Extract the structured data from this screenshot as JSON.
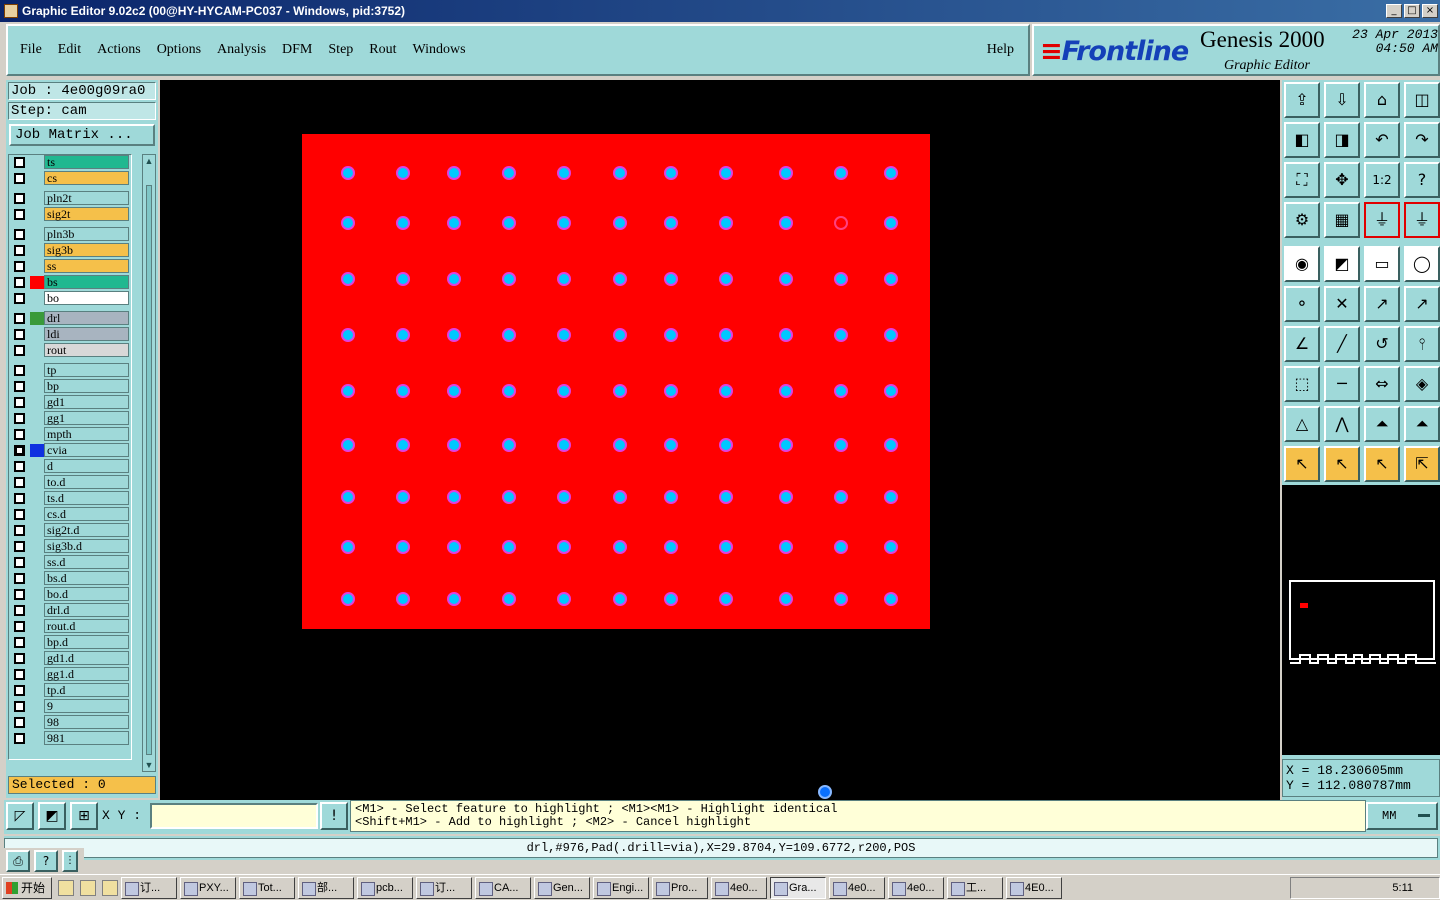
{
  "window": {
    "title": "Graphic Editor 9.02c2 (00@HY-HYCAM-PC037 - Windows, pid:3752)"
  },
  "menu": [
    {
      "label": "File"
    },
    {
      "label": "Edit"
    },
    {
      "label": "Actions"
    },
    {
      "label": "Options"
    },
    {
      "label": "Analysis"
    },
    {
      "label": "DFM"
    },
    {
      "label": "Step"
    },
    {
      "label": "Rout"
    },
    {
      "label": "Windows"
    }
  ],
  "help_label": "Help",
  "brand": {
    "logo": "Frontline",
    "product": "Genesis 2000",
    "subtitle": "Graphic Editor",
    "date": "23 Apr 2013",
    "time": "04:50 AM"
  },
  "job": {
    "job_line": "Job : 4e00g09ra0",
    "step_line": "Step: cam",
    "matrix_button": "Job Matrix ..."
  },
  "layers": [
    {
      "name": "ts",
      "color": "#20b890",
      "swatch": "",
      "on": false
    },
    {
      "name": "cs",
      "color": "#f5c04a",
      "swatch": "",
      "on": false
    },
    {
      "name": "pln2t",
      "color": "#9fd9d9",
      "swatch": "",
      "on": false
    },
    {
      "name": "sig2t",
      "color": "#f5c04a",
      "swatch": "",
      "on": false
    },
    {
      "name": "pln3b",
      "color": "#9fd9d9",
      "swatch": "",
      "on": false
    },
    {
      "name": "sig3b",
      "color": "#f5c04a",
      "swatch": "",
      "on": false
    },
    {
      "name": "ss",
      "color": "#f5c04a",
      "swatch": "",
      "on": false
    },
    {
      "name": "bs",
      "color": "#20b890",
      "swatch": "#ff0000",
      "on": false
    },
    {
      "name": "bo",
      "color": "#ffffff",
      "swatch": "",
      "on": false
    },
    {
      "name": "drl",
      "color": "#a8b4c0",
      "swatch": "#3a9a3a",
      "on": false
    },
    {
      "name": "ldi",
      "color": "#a8b4c0",
      "swatch": "",
      "on": false
    },
    {
      "name": "rout",
      "color": "#d8d8d8",
      "swatch": "",
      "on": false
    },
    {
      "name": "tp",
      "color": "#9fd9d9",
      "swatch": "",
      "on": false
    },
    {
      "name": "bp",
      "color": "#9fd9d9",
      "swatch": "",
      "on": false
    },
    {
      "name": "gd1",
      "color": "#9fd9d9",
      "swatch": "",
      "on": false
    },
    {
      "name": "gg1",
      "color": "#9fd9d9",
      "swatch": "",
      "on": false
    },
    {
      "name": "mpth",
      "color": "#9fd9d9",
      "swatch": "",
      "on": false
    },
    {
      "name": "cvia",
      "color": "#9fd9d9",
      "swatch": "#1030e0",
      "on": true
    },
    {
      "name": "d",
      "color": "#9fd9d9",
      "swatch": "",
      "on": false
    },
    {
      "name": "to.d",
      "color": "#9fd9d9",
      "swatch": "",
      "on": false
    },
    {
      "name": "ts.d",
      "color": "#9fd9d9",
      "swatch": "",
      "on": false
    },
    {
      "name": "cs.d",
      "color": "#9fd9d9",
      "swatch": "",
      "on": false
    },
    {
      "name": "sig2t.d",
      "color": "#9fd9d9",
      "swatch": "",
      "on": false
    },
    {
      "name": "sig3b.d",
      "color": "#9fd9d9",
      "swatch": "",
      "on": false
    },
    {
      "name": "ss.d",
      "color": "#9fd9d9",
      "swatch": "",
      "on": false
    },
    {
      "name": "bs.d",
      "color": "#9fd9d9",
      "swatch": "",
      "on": false
    },
    {
      "name": "bo.d",
      "color": "#9fd9d9",
      "swatch": "",
      "on": false
    },
    {
      "name": "drl.d",
      "color": "#9fd9d9",
      "swatch": "",
      "on": false
    },
    {
      "name": "rout.d",
      "color": "#9fd9d9",
      "swatch": "",
      "on": false
    },
    {
      "name": "bp.d",
      "color": "#9fd9d9",
      "swatch": "",
      "on": false
    },
    {
      "name": "gd1.d",
      "color": "#9fd9d9",
      "swatch": "",
      "on": false
    },
    {
      "name": "gg1.d",
      "color": "#9fd9d9",
      "swatch": "",
      "on": false
    },
    {
      "name": "tp.d",
      "color": "#9fd9d9",
      "swatch": "",
      "on": false
    },
    {
      "name": "9",
      "color": "#9fd9d9",
      "swatch": "",
      "on": false
    },
    {
      "name": "98",
      "color": "#9fd9d9",
      "swatch": "",
      "on": false
    },
    {
      "name": "981",
      "color": "#9fd9d9",
      "swatch": "",
      "on": false
    }
  ],
  "selected_text": "Selected : 0",
  "canvas": {
    "board_color": "#ff0000",
    "pad_color": "#00c8ff",
    "pad_ring_color": "#e040e0",
    "pad_rows": 9,
    "pad_cols": 11,
    "highlighted_pad": {
      "row": 2,
      "col": 10
    }
  },
  "coords": {
    "x_line": "X = 18.230605mm",
    "y_line": "Y = 112.080787mm"
  },
  "xy_label": "X Y :",
  "xy_value": "",
  "hint_line1": "<M1> - Select feature to highlight ; <M1><M1> - Highlight identical",
  "hint_line2": "<Shift+M1> - Add to highlight ; <M2> - Cancel highlight",
  "units": "MM",
  "status": "drl,#976,Pad(.drill=via),X=29.8704,Y=109.6772,r200,POS",
  "taskbar": {
    "start": "开始",
    "tasks": [
      "订...",
      "PXY...",
      "Tot...",
      "部...",
      "pcb...",
      "订...",
      "CA...",
      "Gen...",
      "Engi...",
      "Pro...",
      "4e0...",
      "Gra...",
      "4e0...",
      "4e0...",
      "工...",
      "4E0..."
    ],
    "active_index": 11,
    "clock": "5:11"
  }
}
